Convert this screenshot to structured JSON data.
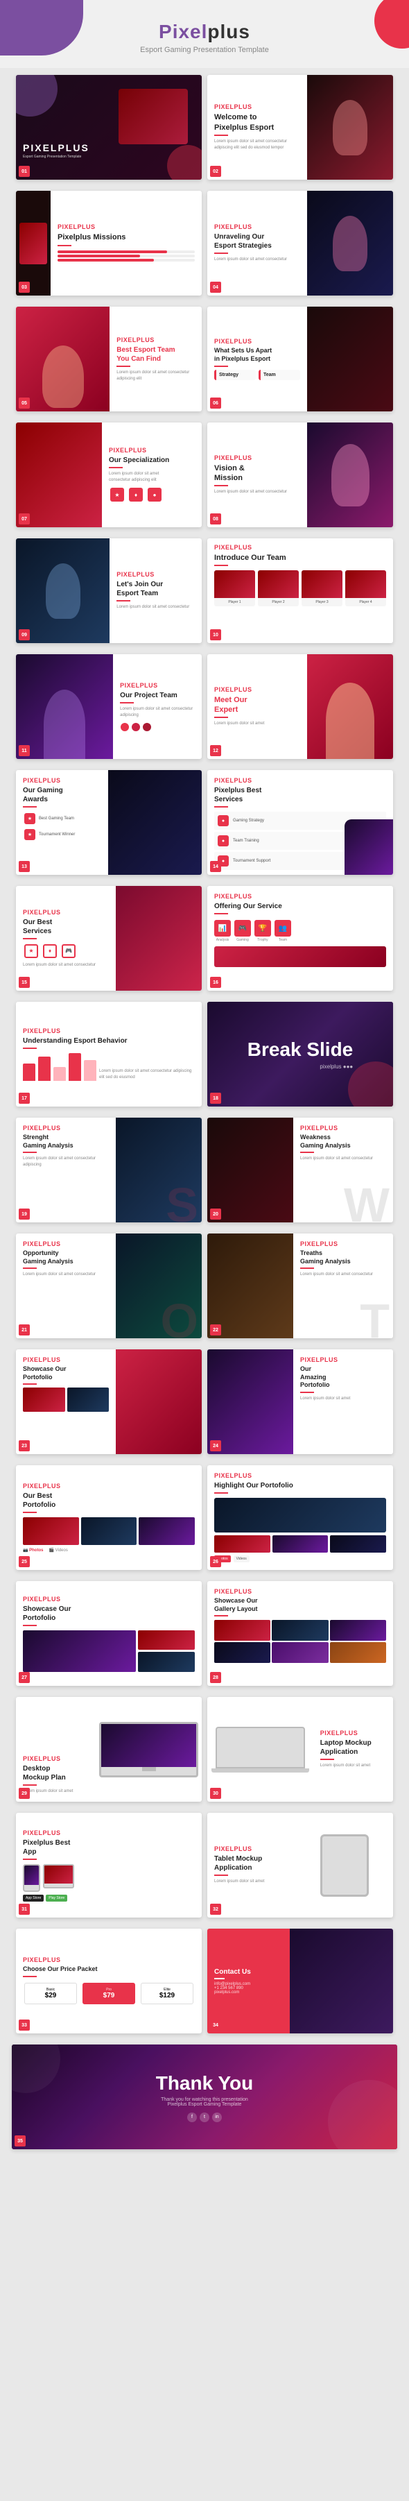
{
  "header": {
    "brand": "Pixelplus",
    "subtitle": "Esport Gaming Presentation Template"
  },
  "slides": [
    {
      "id": 1,
      "type": "cover",
      "title": "PIXELPLUS",
      "subtitle": "Esport Gaming Presentation Template"
    },
    {
      "id": 2,
      "type": "welcome",
      "label": "Pixelplus",
      "heading": "Welcome to Pixelplus Esport"
    },
    {
      "id": 3,
      "type": "missions",
      "label": "Pixelplus",
      "title": "Pixelplus Missions"
    },
    {
      "id": 4,
      "type": "unraveling",
      "title": "Unraveling Our Esport Strategies"
    },
    {
      "id": 5,
      "type": "best-team",
      "title": "Best Esport Team You Can Find"
    },
    {
      "id": 6,
      "type": "what-sets",
      "title": "What Sets Us Apart in Pixelplus Esport"
    },
    {
      "id": 7,
      "type": "specialization",
      "title": "Our Specialization"
    },
    {
      "id": 8,
      "type": "vision",
      "title": "Vision & Mission"
    },
    {
      "id": 9,
      "type": "letsjoin",
      "title": "Let's Join Our Esport Team"
    },
    {
      "id": 10,
      "type": "introduce",
      "title": "Introduce Our Team"
    },
    {
      "id": 11,
      "type": "project",
      "title": "Our Project Team"
    },
    {
      "id": 12,
      "type": "meet-expert",
      "title": "Meet Our Expert"
    },
    {
      "id": 13,
      "type": "gaming-awards",
      "title": "Our Gaming Awards"
    },
    {
      "id": 14,
      "type": "best-services",
      "title": "Pixelplus Best Services"
    },
    {
      "id": 15,
      "type": "our-best",
      "title": "Our Best Services"
    },
    {
      "id": 16,
      "type": "offering",
      "title": "Offering Our Service"
    },
    {
      "id": 17,
      "type": "understanding",
      "title": "Understanding Esport Behavior"
    },
    {
      "id": 18,
      "type": "break",
      "title": "Break Slide"
    },
    {
      "id": 19,
      "type": "strength-swot",
      "letter": "S",
      "title": "Strenght Gaming Analysis"
    },
    {
      "id": 20,
      "type": "weakness-swot",
      "letter": "W",
      "title": "Weakness Gaming Analysis"
    },
    {
      "id": 21,
      "type": "opportunity-swot",
      "letter": "O",
      "title": "Opportunity Gaming Analysis"
    },
    {
      "id": 22,
      "type": "threats-swot",
      "letter": "T",
      "title": "Treaths Gaming Analysis"
    },
    {
      "id": 23,
      "type": "showcase",
      "title": "Showcase Our Portofolio"
    },
    {
      "id": 24,
      "type": "amazing",
      "title": "Our Amazing Portofolio"
    },
    {
      "id": 25,
      "type": "best-porto",
      "title": "Our Best Portofolio"
    },
    {
      "id": 26,
      "type": "highlight",
      "title": "Highlight Our Portofolio"
    },
    {
      "id": 27,
      "type": "showcase2",
      "title": "Showcase Our Portofolio"
    },
    {
      "id": 28,
      "type": "gallery",
      "title": "Showcase Our Gallery Layout"
    },
    {
      "id": 29,
      "type": "desktop-mockup",
      "title": "Desktop Mockup Plan"
    },
    {
      "id": 30,
      "type": "laptop-mockup",
      "title": "Laptop Mockup Application"
    },
    {
      "id": 31,
      "type": "best-app",
      "title": "Pixelplus Best App"
    },
    {
      "id": 32,
      "type": "tablet-mockup",
      "title": "Tablet Mockup Application"
    },
    {
      "id": 33,
      "type": "choose-price",
      "title": "Choose Our Price Packet"
    },
    {
      "id": 34,
      "type": "contact",
      "title": "Contact Us"
    },
    {
      "id": 35,
      "type": "thankyou",
      "title": "Thank You"
    }
  ],
  "colors": {
    "red": "#e8334a",
    "dark": "#1a1a2e",
    "purple": "#7b4fa0",
    "white": "#ffffff",
    "gray": "#888888"
  },
  "labels": {
    "brand": "Pixelplus",
    "tagline": "Esport Gaming Presentation Template",
    "slide_label": "pixelplus"
  }
}
